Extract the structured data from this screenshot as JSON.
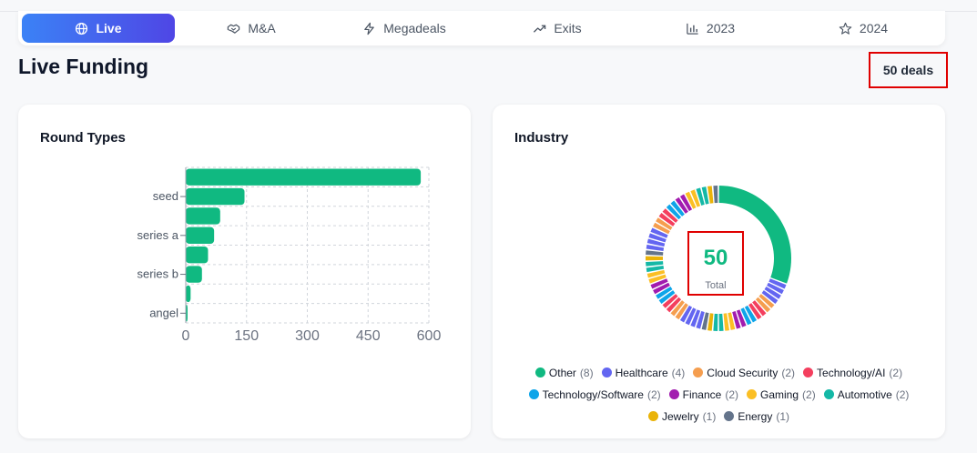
{
  "tabs": [
    {
      "label": "Live",
      "icon": "globe-icon",
      "active": true
    },
    {
      "label": "M&A",
      "icon": "handshake-icon",
      "active": false
    },
    {
      "label": "Megadeals",
      "icon": "lightning-icon",
      "active": false
    },
    {
      "label": "Exits",
      "icon": "trending-up-icon",
      "active": false
    },
    {
      "label": "2023",
      "icon": "bar-chart-icon",
      "active": false
    },
    {
      "label": "2024",
      "icon": "star-icon",
      "active": false
    }
  ],
  "page": {
    "title": "Live Funding",
    "deal_count": "50 deals"
  },
  "round_types_card": {
    "title": "Round Types"
  },
  "industry_card": {
    "title": "Industry",
    "total_value": "50",
    "total_label": "Total",
    "legend": [
      {
        "label": "Other",
        "count": "(8)",
        "color": "#10b981"
      },
      {
        "label": "Healthcare",
        "count": "(4)",
        "color": "#6366f1"
      },
      {
        "label": "Cloud Security",
        "count": "(2)",
        "color": "#f59e4f"
      },
      {
        "label": "Technology/AI",
        "count": "(2)",
        "color": "#f43f5e"
      },
      {
        "label": "Technology/Software",
        "count": "(2)",
        "color": "#0ea5e9"
      },
      {
        "label": "Finance",
        "count": "(2)",
        "color": "#a21caf"
      },
      {
        "label": "Gaming",
        "count": "(2)",
        "color": "#fbbf24"
      },
      {
        "label": "Automotive",
        "count": "(2)",
        "color": "#14b8a6"
      },
      {
        "label": "Jewelry",
        "count": "(1)",
        "color": "#eab308"
      },
      {
        "label": "Energy",
        "count": "(1)",
        "color": "#64748b"
      }
    ]
  },
  "chart_data": [
    {
      "type": "bar",
      "orientation": "horizontal",
      "title": "Round Types",
      "categories": [
        "",
        "seed",
        "",
        "series a",
        "",
        "series b",
        "",
        "angel"
      ],
      "values": [
        580,
        145,
        85,
        70,
        55,
        40,
        12,
        3
      ],
      "color": "#10b981",
      "xlim": [
        0,
        600
      ],
      "xticks": [
        0,
        150,
        300,
        450,
        600
      ],
      "grid": true
    },
    {
      "type": "pie",
      "style": "donut",
      "title": "Industry",
      "categories": [
        "Other",
        "Healthcare",
        "Cloud Security",
        "Technology/AI",
        "Technology/Software",
        "Finance",
        "Gaming",
        "Automotive",
        "Jewelry",
        "Energy"
      ],
      "values": [
        8,
        4,
        2,
        2,
        2,
        2,
        2,
        2,
        1,
        1
      ],
      "legend_position": "bottom"
    }
  ]
}
